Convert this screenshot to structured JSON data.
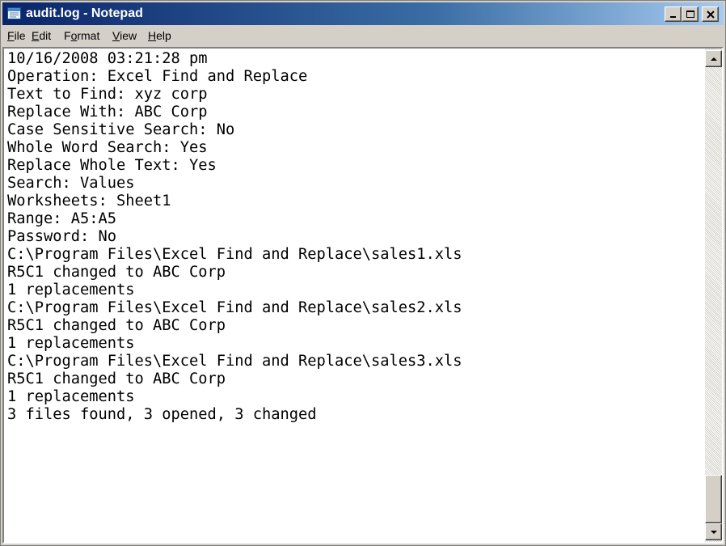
{
  "window": {
    "title": "audit.log - Notepad",
    "icon": "notepad-icon",
    "controls": {
      "minimize": "minimize-icon",
      "maximize": "maximize-icon",
      "close": "close-icon"
    }
  },
  "menu": {
    "items": [
      {
        "label": "File",
        "access_key": "F",
        "rest": "ile"
      },
      {
        "label": "Edit",
        "access_key": "E",
        "rest": "dit"
      },
      {
        "label": "Format",
        "access_key_prefix": "F",
        "access_key": "o",
        "rest": "rmat"
      },
      {
        "label": "View",
        "access_key": "V",
        "rest": "iew"
      },
      {
        "label": "Help",
        "access_key": "H",
        "rest": "elp"
      }
    ]
  },
  "document": {
    "lines": [
      "10/16/2008 03:21:28 pm",
      "Operation: Excel Find and Replace",
      "Text to Find: xyz corp",
      "Replace With: ABC Corp",
      "Case Sensitive Search: No",
      "Whole Word Search: Yes",
      "Replace Whole Text: Yes",
      "Search: Values",
      "Worksheets: Sheet1",
      "Range: A5:A5",
      "Password: No",
      "C:\\Program Files\\Excel Find and Replace\\sales1.xls",
      "R5C1 changed to ABC Corp",
      "1 replacements",
      "C:\\Program Files\\Excel Find and Replace\\sales2.xls",
      "R5C1 changed to ABC Corp",
      "1 replacements",
      "C:\\Program Files\\Excel Find and Replace\\sales3.xls",
      "R5C1 changed to ABC Corp",
      "1 replacements",
      "3 files found, 3 opened, 3 changed",
      ""
    ]
  },
  "scrollbar": {
    "up_icon": "scroll-up-arrow-icon",
    "down_icon": "scroll-down-arrow-icon",
    "position": 1.0
  },
  "colors": {
    "title_bar_start": "#0a246a",
    "title_bar_end": "#a6caf0",
    "face": "#d4d0c8",
    "text": "#000000",
    "background": "#ffffff"
  }
}
